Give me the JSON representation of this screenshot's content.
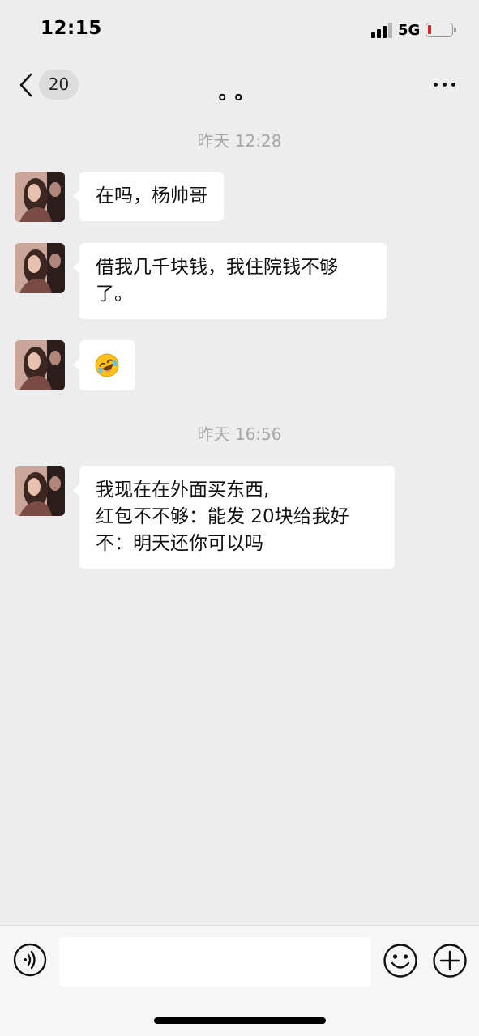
{
  "status_bar": {
    "time": "12:15",
    "network": "5G",
    "signal_icon": "cellular-signal-icon",
    "battery_icon": "battery-low-icon",
    "battery_color": "#e0201c"
  },
  "nav": {
    "back_icon": "chevron-left-icon",
    "unread_count": "20",
    "title": "。。",
    "more_icon": "ellipsis-icon"
  },
  "messages": [
    {
      "type": "timestamp",
      "text": "昨天 12:28"
    },
    {
      "type": "received",
      "lines": [
        "在吗，杨帅哥"
      ]
    },
    {
      "type": "received",
      "lines": [
        "借我几千块钱，我住院钱不够",
        "了。"
      ]
    },
    {
      "type": "received",
      "lines": [
        "🤣"
      ]
    },
    {
      "type": "timestamp",
      "text": "昨天 16:56"
    },
    {
      "type": "received",
      "lines": [
        "我现在在外面买东西,",
        "红包不不够：能发 20块给我好",
        "不：明天还你可以吗"
      ]
    }
  ],
  "input_bar": {
    "voice_icon": "voice-input-icon",
    "text_value": "",
    "emoji_icon": "smiley-icon",
    "plus_icon": "plus-circle-icon"
  },
  "colors": {
    "background": "#ededed",
    "bubble": "#ffffff",
    "timestamp": "#a6a6a6"
  }
}
